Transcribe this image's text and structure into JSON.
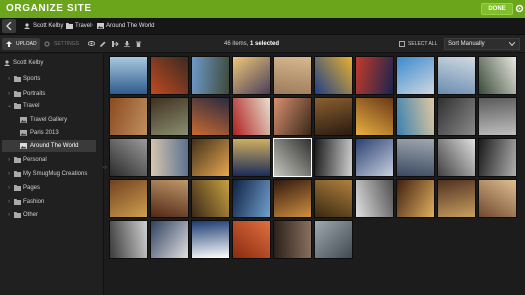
{
  "app": {
    "title": "ORGANIZE SITE",
    "done_label": "DONE"
  },
  "breadcrumb": [
    "Scott Kelby",
    "Travel",
    "Around The World"
  ],
  "toolbar": {
    "upload_label": "UPLOAD",
    "settings_label": "SETTINGS",
    "count_prefix": "46 items, ",
    "count_selected": "1 selected",
    "select_all_label": "SELECT ALL",
    "sort_value": "Sort Manually"
  },
  "sidebar": {
    "items": [
      {
        "label": "Scott Kelby",
        "icon": "user-icon"
      },
      {
        "label": "Sports",
        "icon": "folder-icon"
      },
      {
        "label": "Portraits",
        "icon": "folder-icon"
      },
      {
        "label": "Travel",
        "icon": "folder-open-icon"
      },
      {
        "label": "Travel Gallery",
        "icon": "gallery-icon"
      },
      {
        "label": "Paris 2013",
        "icon": "gallery-icon"
      },
      {
        "label": "Around The World",
        "icon": "gallery-icon",
        "selected": true
      },
      {
        "label": "Personal",
        "icon": "folder-icon"
      },
      {
        "label": "My SmugMug Creations",
        "icon": "folder-icon"
      },
      {
        "label": "Pages",
        "icon": "folder-icon"
      },
      {
        "label": "Fashion",
        "icon": "folder-icon"
      },
      {
        "label": "Other",
        "icon": "folder-icon"
      }
    ]
  },
  "colors": {
    "accent": "#6aa51b",
    "background": "#1c1c1c"
  },
  "grid": {
    "columns": 10,
    "selected_index": 24,
    "photos": [
      "#2f5c8c,#a8c8e0",
      "#c04a20,#3a2a22",
      "#6d9ac8,#3f4a3c",
      "#f0c878,#4a3e5a",
      "#9c7c5a,#d8b890",
      "#1e3f8a,#e8b030",
      "#c43a2a,#1a2450",
      "#3a8ad0,#d0d8e0",
      "#6a8cb0,#d0dae0",
      "#3a4a3a,#e8e8e0",
      "#8a4a20,#c09060",
      "#403020,#8a9070",
      "#c86a30,#2a2a40",
      "#b02020,#e8e0d0",
      "#d89070,#3a2818",
      "#8a6030,#2a1a10",
      "#e8b040,#6a3818",
      "#3a80b0,#e0c8a0",
      "#303030,#8a8a8a",
      "#5a5a5a,#c0c0c0",
      "#2a2a2a,#9a9a9a",
      "#d8c8b0,#5a7090",
      "#40301a,#e8a850",
      "#1a2a5a,#d0b060",
      "#c8c8c0,#303030",
      "#1a1a1a,#d0d0d0",
      "#2a4070,#c8d0e0",
      "#3a4860,#a0a8b0",
      "#404040,#e0e0e0",
      "#1a1a1a,#b0b0b0",
      "#704020,#d0a050",
      "#502818,#c09868",
      "#3a2818,#c8a040",
      "#102040,#70a0d0",
      "#301810,#d09040",
      "#3a2a10,#b08040",
      "#e0e0e0,#505050",
      "#402010,#e0b060",
      "#503020,#c8a060",
      "#704830,#e0c090",
      "#3a3a3a,#d0d0d0",
      "#304060,#e0e0e0",
      "#1a3a70,#ffffff",
      "#8a2a10,#e07040",
      "#2a2018,#8a7060",
      "#a0a8b0,#404850"
    ]
  }
}
